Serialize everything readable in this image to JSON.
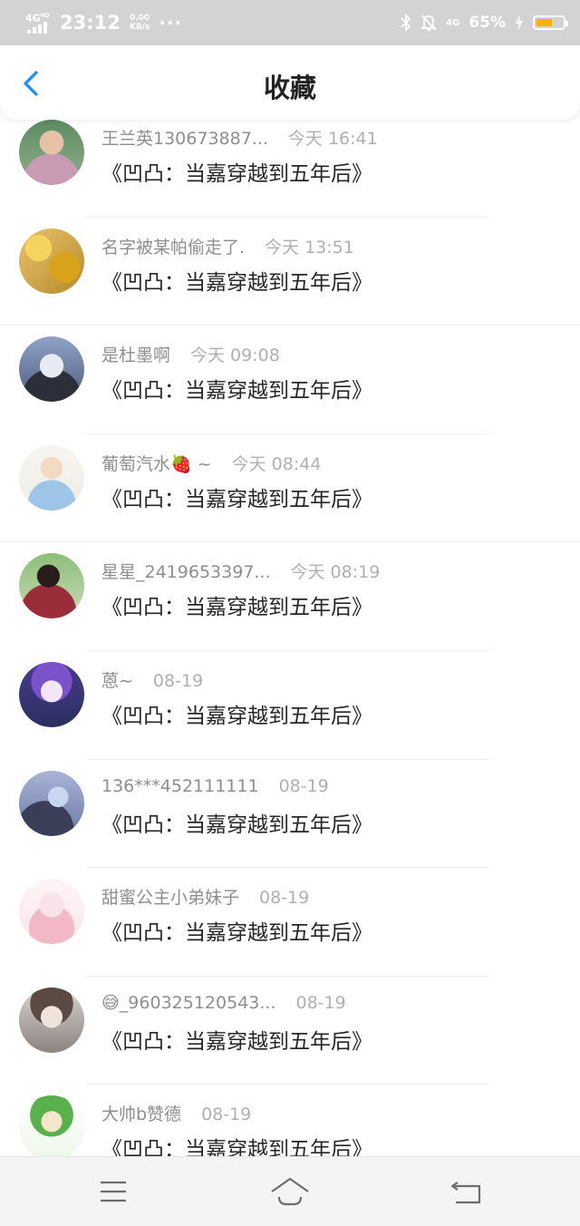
{
  "status_bar": {
    "network": "4G",
    "network_sup": "HD",
    "time": "23:12",
    "speed_value": "0.00",
    "speed_unit": "KB/s",
    "more": "···",
    "data_type": "4G",
    "battery_percent": "65%",
    "battery_level": 0.65
  },
  "header": {
    "title": "收藏"
  },
  "favorites": [
    {
      "name": "王兰英130673887...",
      "time": "今天 16:41",
      "title": "《凹凸：当嘉穿越到五年后》"
    },
    {
      "name": "名字被某帕偷走了.",
      "time": "今天 13:51",
      "title": "《凹凸：当嘉穿越到五年后》"
    },
    {
      "name": "是杜墨啊",
      "time": "今天 09:08",
      "title": "《凹凸：当嘉穿越到五年后》"
    },
    {
      "name": "葡萄汽水🍓 ~",
      "time": "今天 08:44",
      "title": "《凹凸：当嘉穿越到五年后》"
    },
    {
      "name": "星星_2419653397...",
      "time": "今天 08:19",
      "title": "《凹凸：当嘉穿越到五年后》"
    },
    {
      "name": "蒽~",
      "time": "08-19",
      "title": "《凹凸：当嘉穿越到五年后》"
    },
    {
      "name": "136***452111111",
      "time": "08-19",
      "title": "《凹凸：当嘉穿越到五年后》"
    },
    {
      "name": "甜蜜公主小弟妹子",
      "time": "08-19",
      "title": "《凹凸：当嘉穿越到五年后》"
    },
    {
      "name": "😅_960325120543...",
      "time": "08-19",
      "title": "《凹凸：当嘉穿越到五年后》"
    },
    {
      "name": "大帅b赞德",
      "time": "08-19",
      "title": "《凹凸：当嘉穿越到五年后》"
    }
  ],
  "colors": {
    "accent": "#1a8cff",
    "status_bar": "#d3d3d3",
    "battery_fill": "#f5b400"
  },
  "icons": {
    "back": "chevron-left-icon",
    "menu": "menu-icon",
    "home": "home-icon",
    "return": "return-icon"
  }
}
